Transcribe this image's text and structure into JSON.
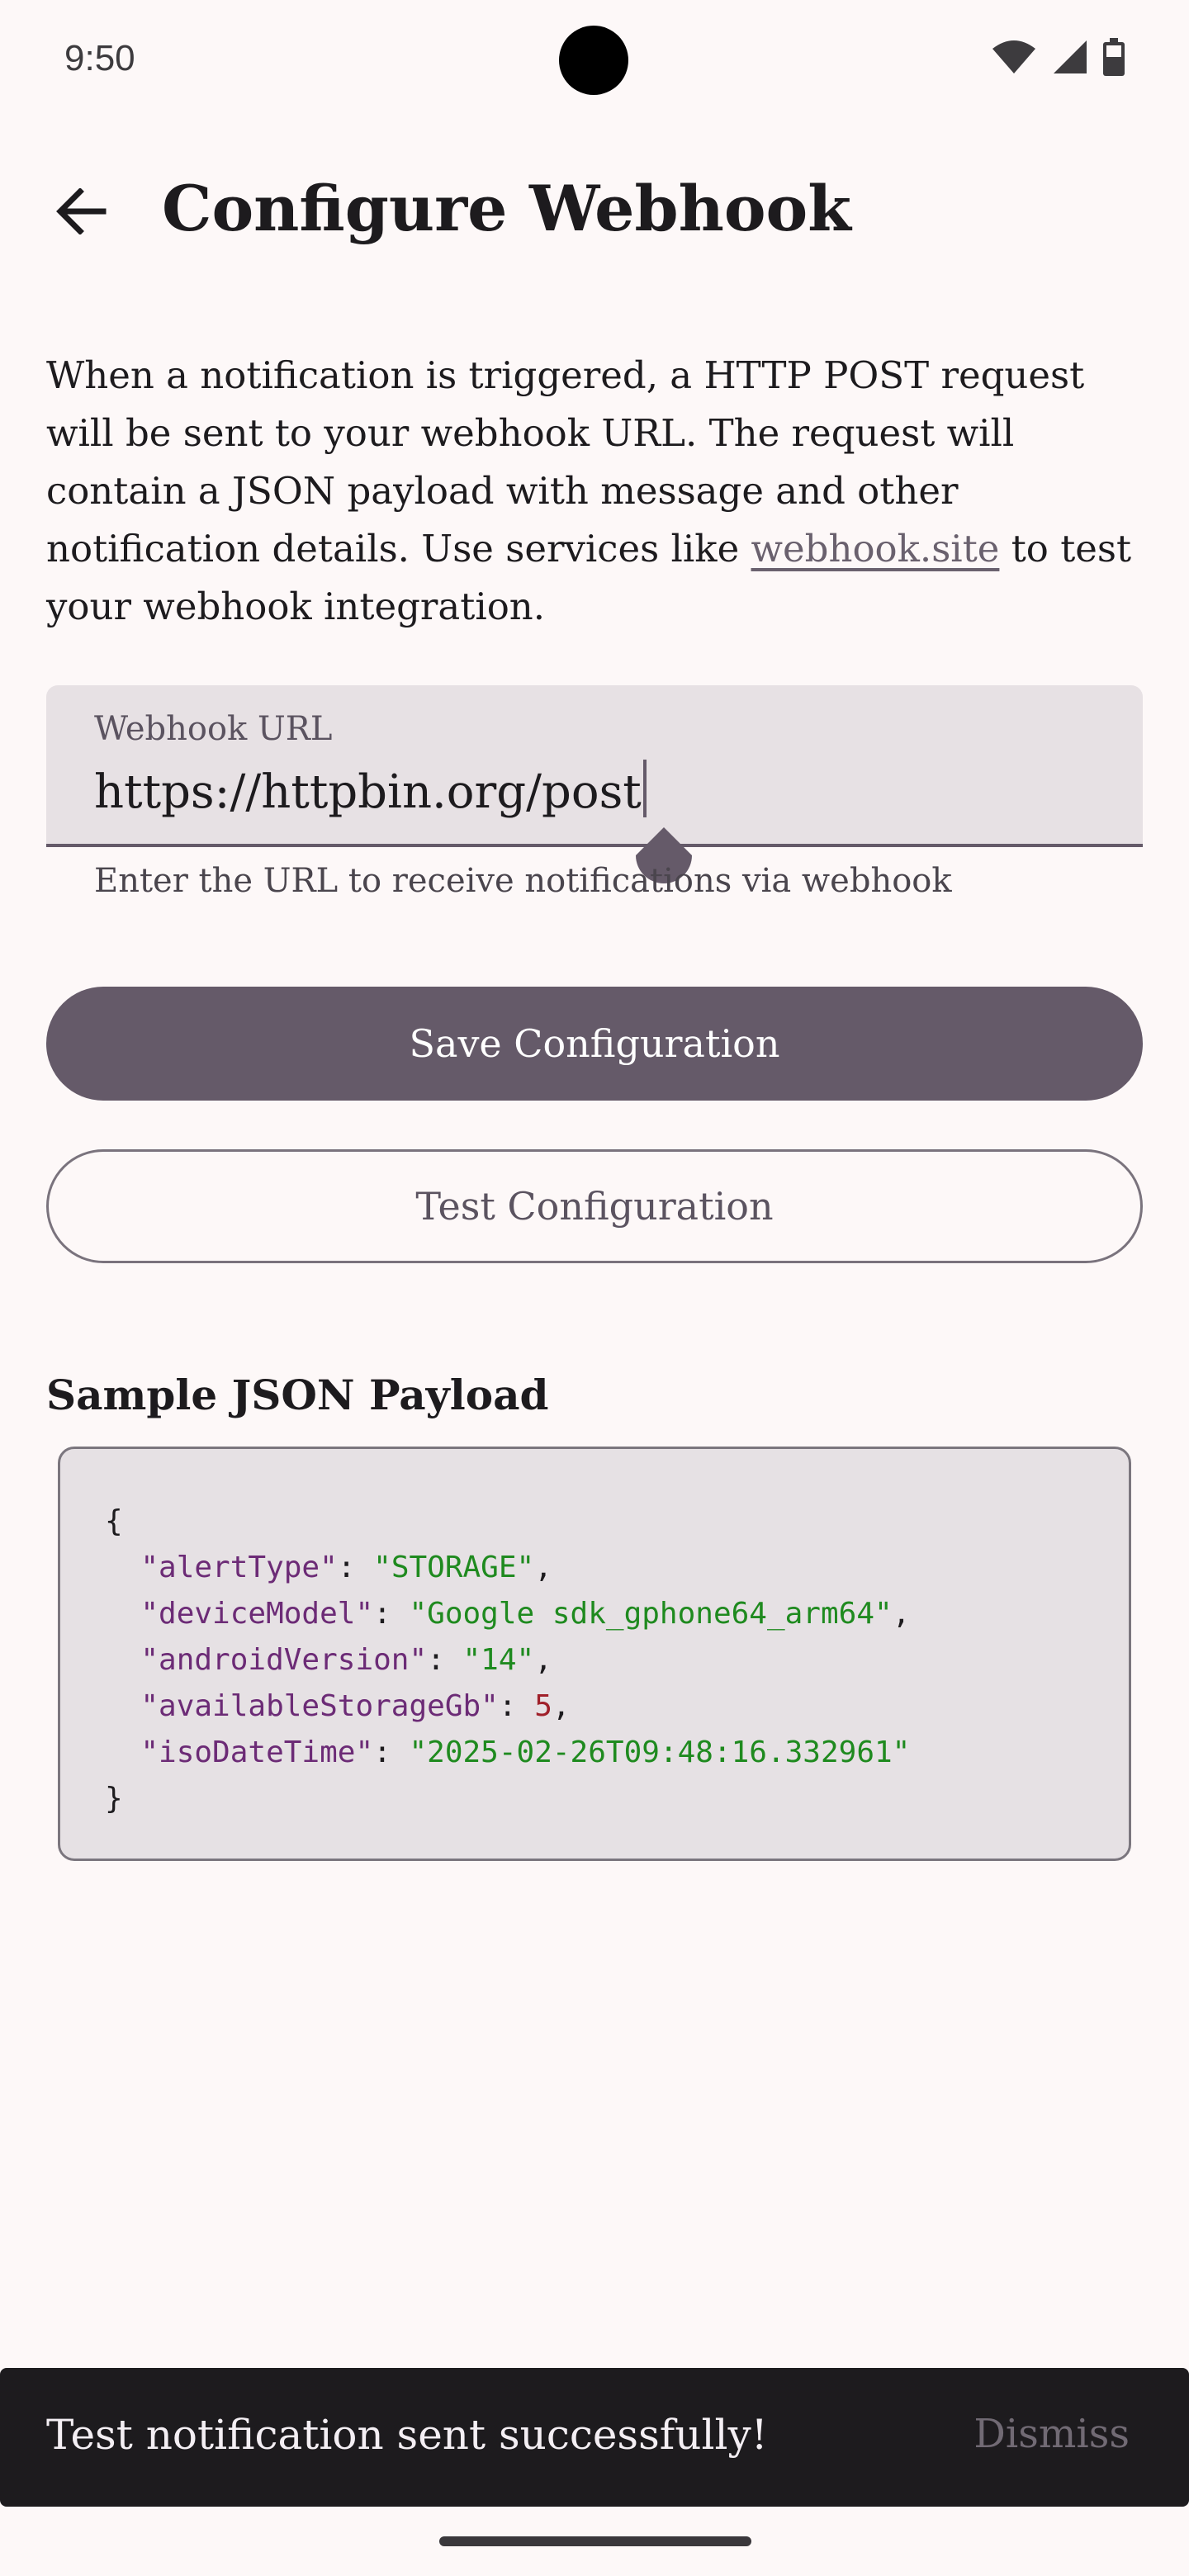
{
  "status_bar": {
    "time": "9:50",
    "icons": [
      "wifi-icon",
      "cell-signal-icon",
      "battery-icon"
    ]
  },
  "top_bar": {
    "back_icon": "arrow-back-icon",
    "title": "Configure Webhook"
  },
  "description": {
    "text_before_link": "When a notification is triggered, a HTTP POST request will be sent to your webhook URL. The request will contain a JSON payload with message and other notification details. Use services like ",
    "link_text": "webhook.site",
    "text_after_link": " to test your webhook integration."
  },
  "webhook_field": {
    "label": "Webhook URL",
    "value": "https://httpbin.org/post",
    "helper": "Enter the URL to receive notifications via webhook"
  },
  "buttons": {
    "save_label": "Save Configuration",
    "test_label": "Test Configuration"
  },
  "sample": {
    "title": "Sample JSON Payload",
    "lines": [
      {
        "key": "alertType",
        "value": "\"STORAGE\"",
        "kind": "str"
      },
      {
        "key": "deviceModel",
        "value": "\"Google sdk_gphone64_arm64\"",
        "kind": "str"
      },
      {
        "key": "androidVersion",
        "value": "\"14\"",
        "kind": "str"
      },
      {
        "key": "availableStorageGb",
        "value": "5",
        "kind": "num"
      },
      {
        "key": "isoDateTime",
        "value": "\"2025-02-26T09:48:16.332961\"",
        "kind": "str"
      }
    ]
  },
  "snackbar": {
    "message": "Test notification sent successfully!",
    "action": "Dismiss"
  },
  "colors": {
    "background": "#fdf8f8",
    "primary": "#655a69",
    "field_bg": "#e7e1e4",
    "json_key": "#6c2b76",
    "json_string": "#1f8a1f",
    "json_number": "#a0202a",
    "snackbar_bg": "#1d1b1e"
  }
}
